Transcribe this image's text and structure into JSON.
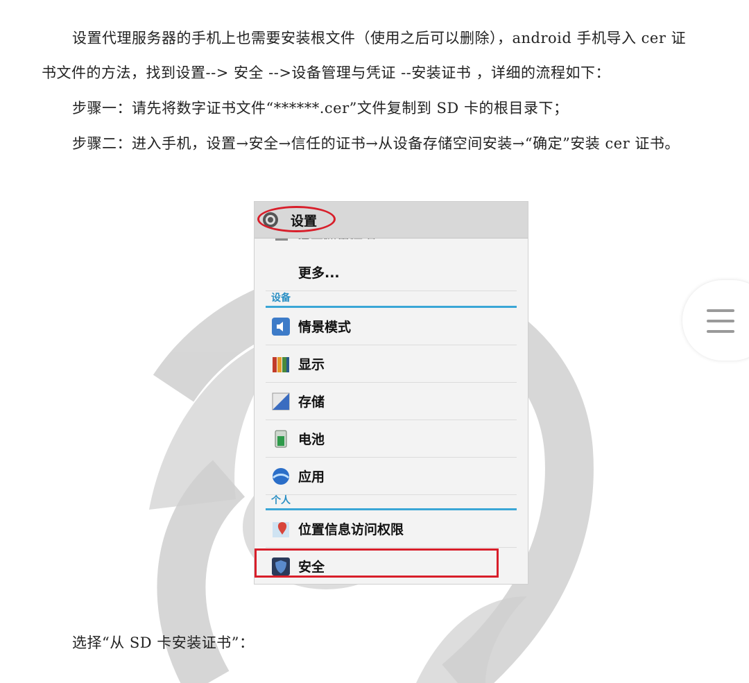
{
  "document": {
    "paragraphs": [
      "设置代理服务器的手机上也需要安装根文件（使用之后可以删除），android 手机导入 cer 证",
      "书文件的方法，找到设置--> 安全 -->设备管理与凭证 --安装证书 ，详细的流程如下：",
      "步骤一：请先将数字证书文件“******.cer”文件复制到 SD 卡的根目录下；",
      "步骤二：进入手机，设置→安全→信任的证书→从设备存储空间安装→“确定”安装 cer 证书。"
    ],
    "after_image": "选择“从 SD 卡安装证书”："
  },
  "phone": {
    "title": "设置",
    "cutoff_text": "流量使用情况",
    "more": "更多...",
    "section_device": "设备",
    "section_personal": "个人",
    "items_device": [
      {
        "label": "情景模式",
        "icon": "sound-profile-icon"
      },
      {
        "label": "显示",
        "icon": "display-icon"
      },
      {
        "label": "存储",
        "icon": "storage-icon"
      },
      {
        "label": "电池",
        "icon": "battery-icon"
      },
      {
        "label": "应用",
        "icon": "apps-icon"
      }
    ],
    "items_personal": [
      {
        "label": "位置信息访问权限",
        "icon": "location-icon"
      },
      {
        "label": "安全",
        "icon": "security-shield-icon"
      }
    ]
  },
  "colors": {
    "annotation_red": "#d81e2a",
    "section_blue": "#3aa6d6"
  }
}
